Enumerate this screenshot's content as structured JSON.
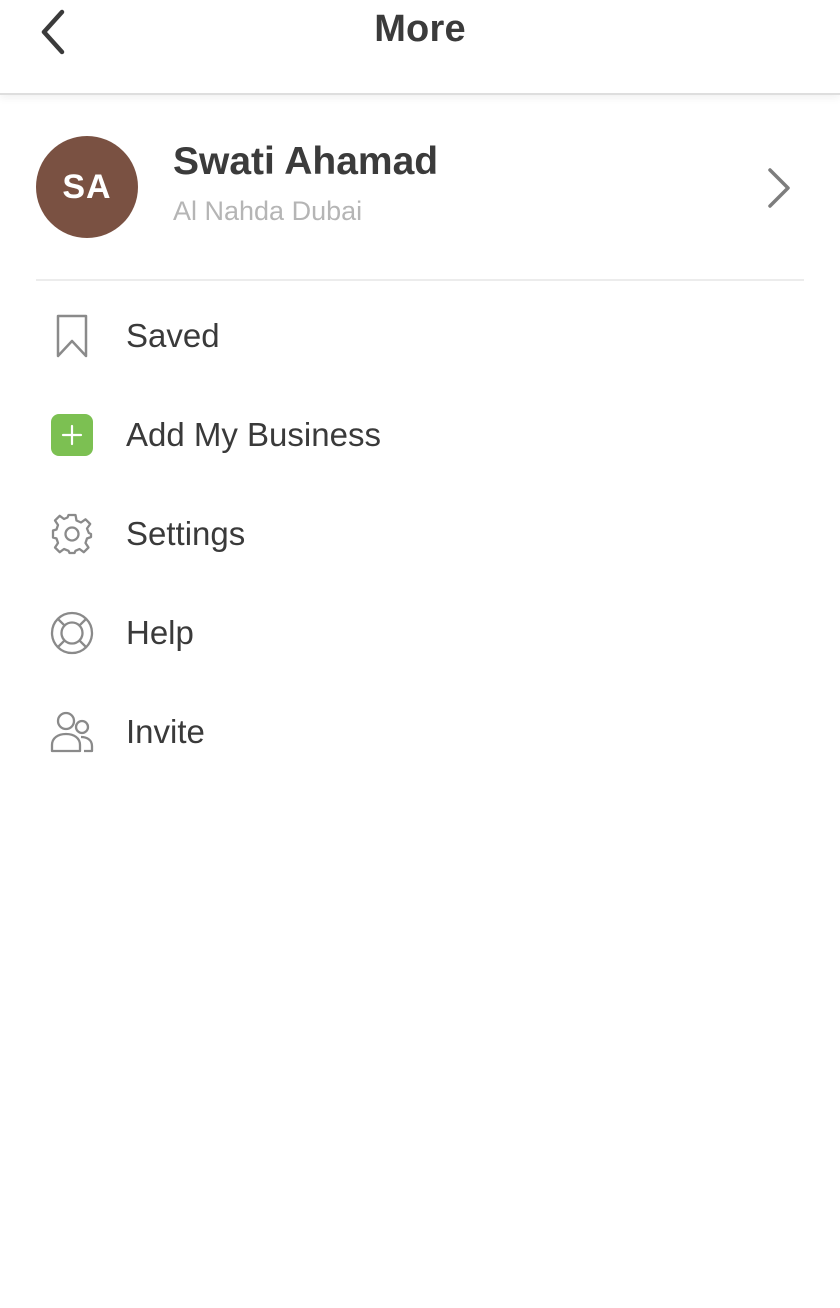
{
  "header": {
    "title": "More",
    "back_icon": "chevron-left-icon"
  },
  "profile": {
    "initials": "SA",
    "name": "Swati Ahamad",
    "location": "Al Nahda Dubai",
    "avatar_color": "#7a5142",
    "chevron_icon": "chevron-right-icon"
  },
  "menu": {
    "items": [
      {
        "label": "Saved",
        "icon": "bookmark-icon"
      },
      {
        "label": "Add My Business",
        "icon": "plus-square-icon",
        "icon_color": "#7cc052"
      },
      {
        "label": "Settings",
        "icon": "gear-icon"
      },
      {
        "label": "Help",
        "icon": "lifebuoy-icon"
      },
      {
        "label": "Invite",
        "icon": "users-icon"
      }
    ]
  }
}
